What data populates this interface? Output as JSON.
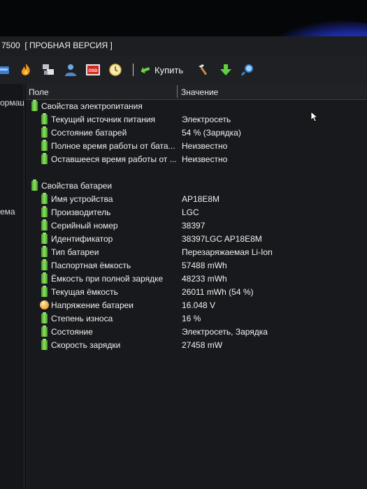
{
  "window": {
    "title": "7500  [ ПРОБНАЯ ВЕРСИЯ ]"
  },
  "toolbar": {
    "icons": [
      "drive-icon",
      "flame-icon",
      "network-icon",
      "user-icon",
      "osd-icon",
      "clock-icon"
    ],
    "osd_label": "OSD",
    "buy_label": "Купить",
    "tools": [
      "wrench-icon",
      "download-arrow-icon",
      "search-icon"
    ]
  },
  "sidebar": {
    "fragments": [
      "ормаци",
      "ема"
    ]
  },
  "columns": {
    "field": "Поле",
    "value": "Значение"
  },
  "power_section": {
    "title": "Свойства электропитания",
    "rows": [
      {
        "label": "Текущий источник питания",
        "value": "Электросеть"
      },
      {
        "label": "Состояние батарей",
        "value": "54 % (Зарядка)"
      },
      {
        "label": "Полное время работы от бата...",
        "value": "Неизвестно"
      },
      {
        "label": "Оставшееся время работы от ...",
        "value": "Неизвестно"
      }
    ]
  },
  "battery_section": {
    "title": "Свойства батареи",
    "rows": [
      {
        "label": "Имя устройства",
        "value": "AP18E8M",
        "icon": "battery-icon"
      },
      {
        "label": "Производитель",
        "value": "LGC",
        "icon": "battery-icon"
      },
      {
        "label": "Серийный номер",
        "value": "38397",
        "icon": "battery-icon"
      },
      {
        "label": "Идентификатор",
        "value": "38397LGC AP18E8M",
        "icon": "battery-icon"
      },
      {
        "label": "Тип батареи",
        "value": "Перезаряжаемая Li-Ion",
        "icon": "battery-icon"
      },
      {
        "label": "Паспортная ёмкость",
        "value": "57488 mWh",
        "icon": "battery-icon"
      },
      {
        "label": "Ёмкость при полной зарядке",
        "value": "48233 mWh",
        "icon": "battery-icon"
      },
      {
        "label": "Текущая ёмкость",
        "value": "26011 mWh  (54 %)",
        "icon": "battery-icon"
      },
      {
        "label": "Напряжение батареи",
        "value": "16.048 V",
        "icon": "voltage-icon"
      },
      {
        "label": "Степень износа",
        "value": "16 %",
        "icon": "battery-icon"
      },
      {
        "label": "Состояние",
        "value": "Электросеть, Зарядка",
        "icon": "battery-icon"
      },
      {
        "label": "Скорость зарядки",
        "value": "27458 mW",
        "icon": "battery-icon"
      }
    ]
  }
}
